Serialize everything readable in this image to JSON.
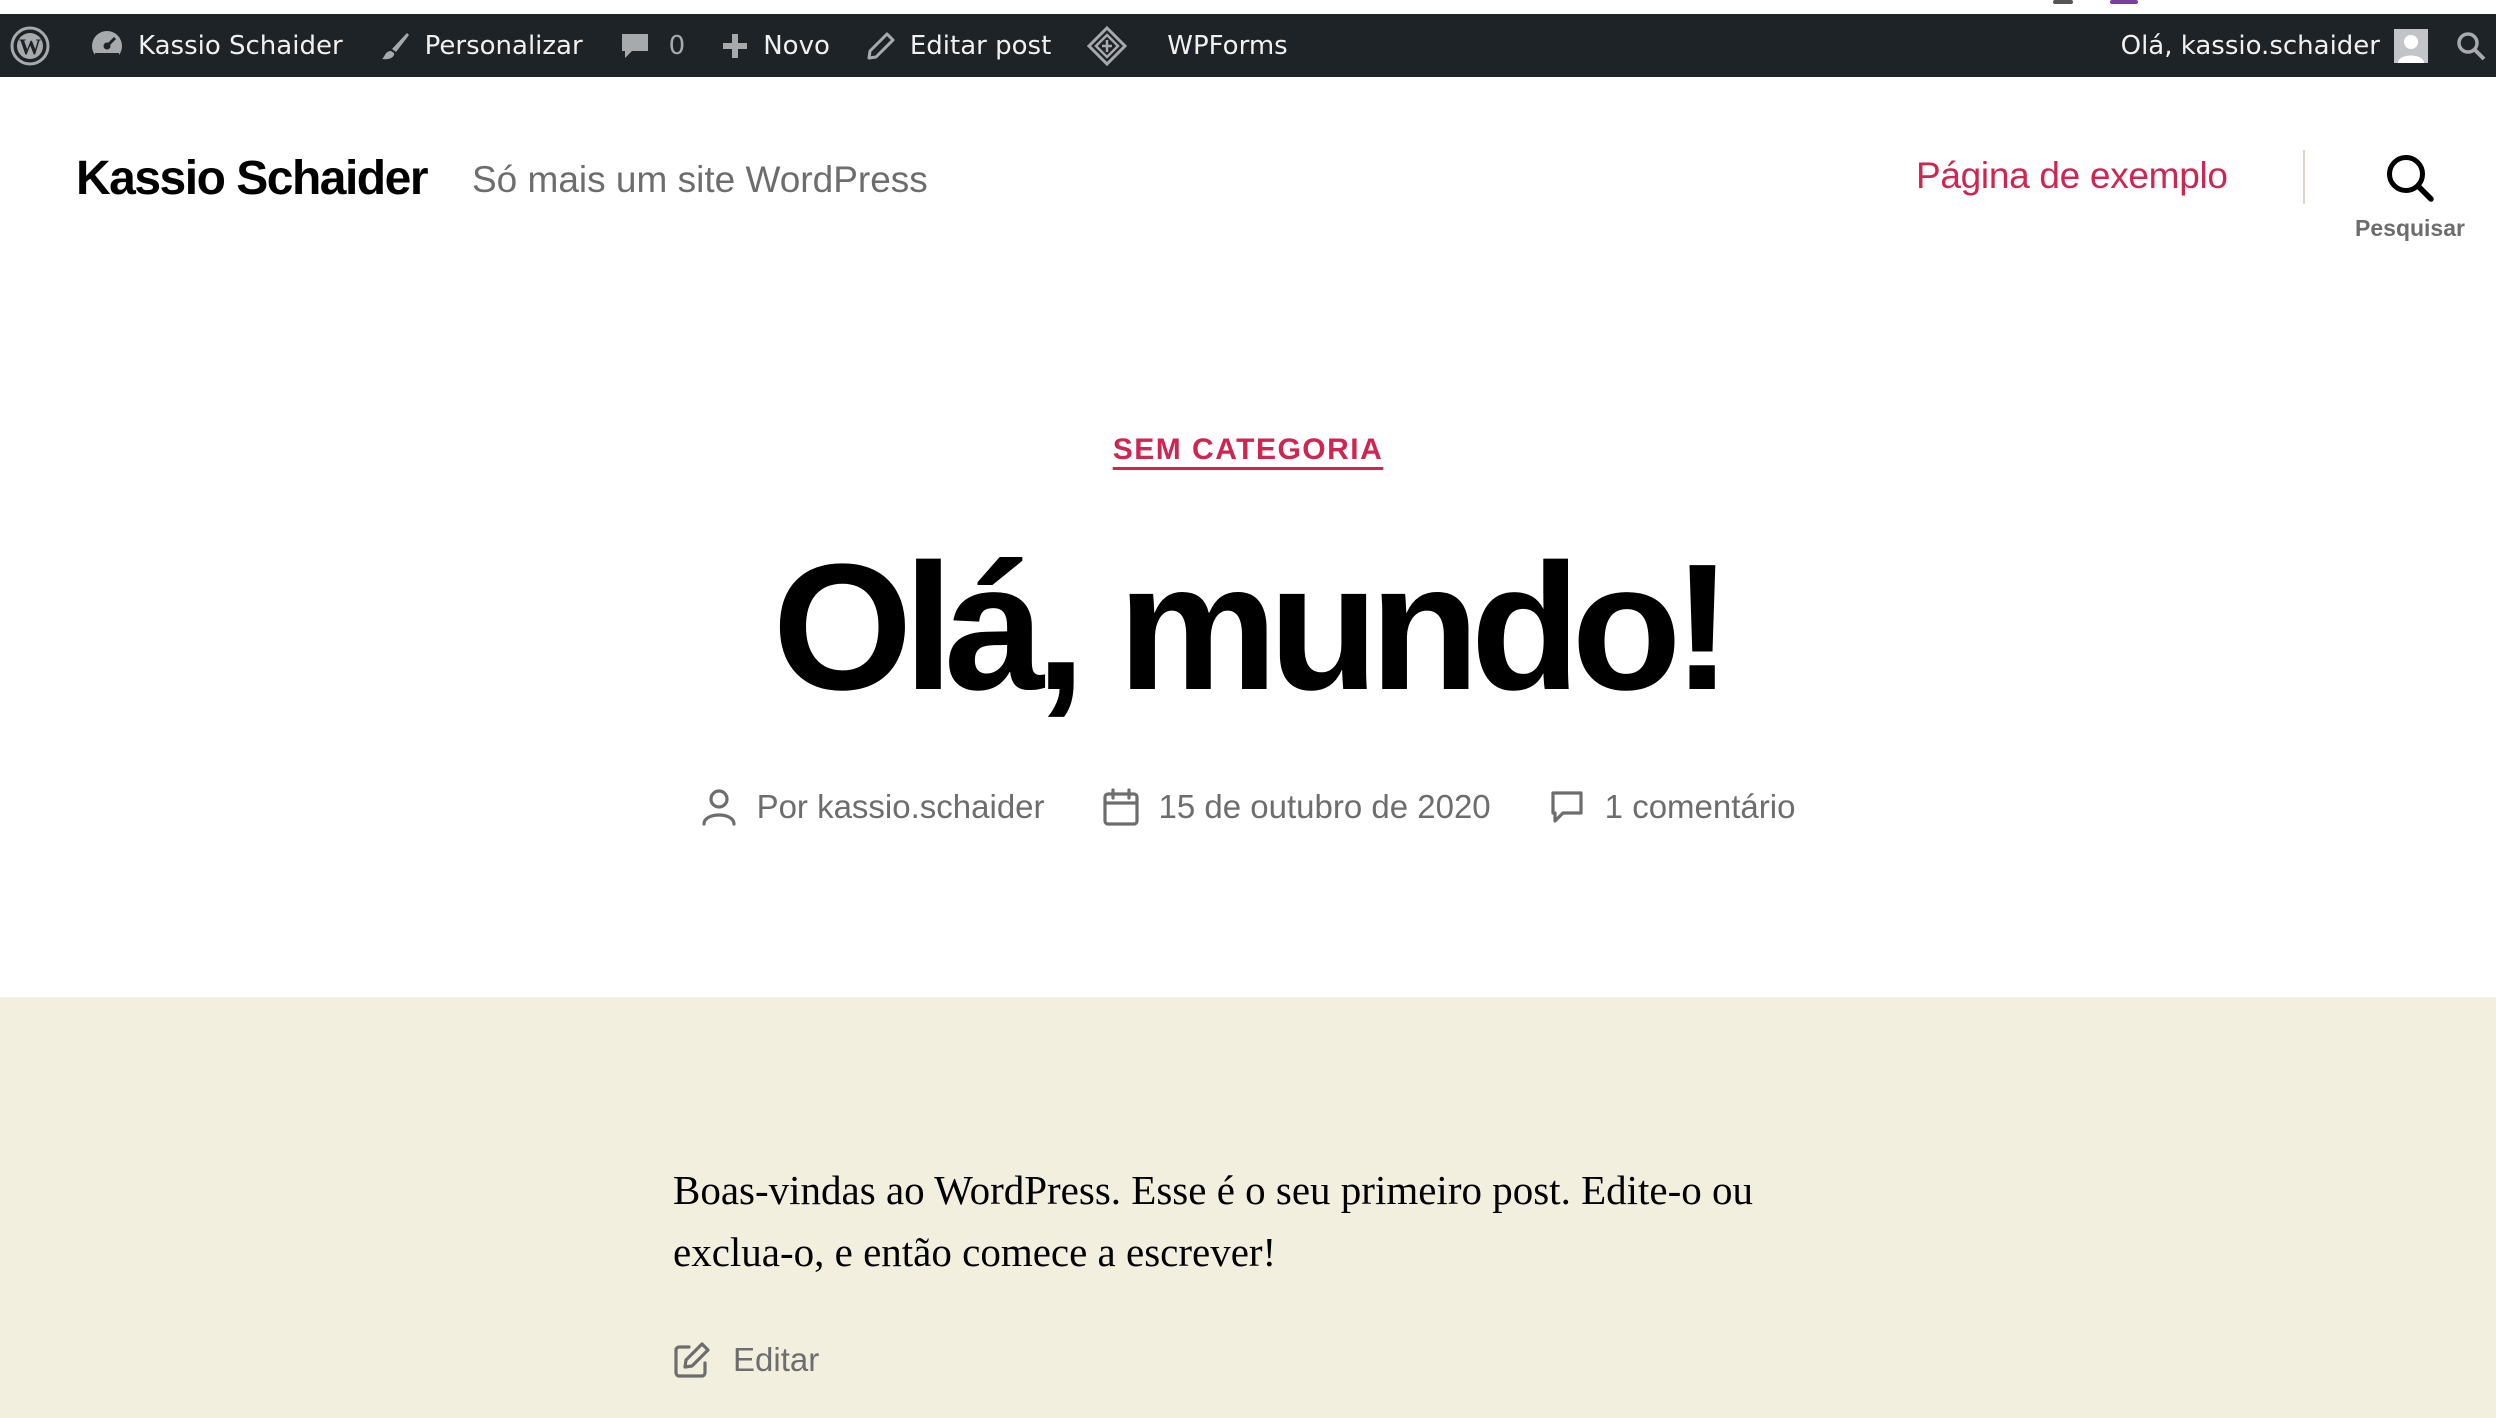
{
  "admin_bar": {
    "site_name": "Kassio Schaider",
    "customize": "Personalizar",
    "comments_count": "0",
    "new": "Novo",
    "edit_post": "Editar post",
    "wpforms": "WPForms",
    "greeting": "Olá, kassio.schaider"
  },
  "header": {
    "site_title": "Kassio Schaider",
    "site_description": "Só mais um site WordPress",
    "nav": [
      {
        "label": "Página de exemplo"
      }
    ],
    "search_label": "Pesquisar"
  },
  "post": {
    "category": "SEM CATEGORIA",
    "title": "Olá, mundo!",
    "author": "Por kassio.schaider",
    "date": "15 de outubro de 2020",
    "comments": "1 comentário",
    "body": "Boas-vindas ao WordPress. Esse é o seu primeiro post. Edite-o ou exclua-o, e então comece a escrever!",
    "edit_label": "Editar"
  },
  "colors": {
    "admin_bar_bg": "#1d2327",
    "accent": "#cd2653",
    "content_bg": "#f3efdf",
    "muted_text": "#6d6d6d"
  },
  "icons": [
    "wordpress-logo-icon",
    "dashboard-icon",
    "paintbrush-icon",
    "comment-bubble-icon",
    "plus-icon",
    "pencil-icon",
    "wpforms-icon",
    "user-avatar-icon",
    "search-icon",
    "person-icon",
    "calendar-icon",
    "comment-icon",
    "edit-icon"
  ]
}
